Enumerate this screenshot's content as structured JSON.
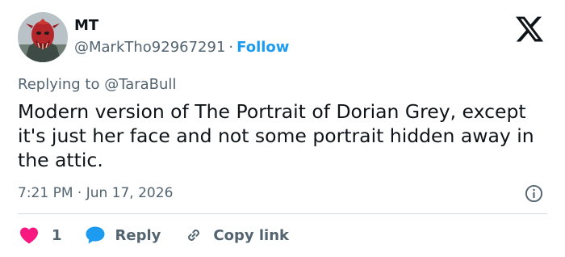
{
  "author": {
    "name": "MT",
    "handle": "@MarkTho92967291",
    "separator": "·",
    "follow_label": "Follow"
  },
  "reply_context": {
    "prefix": "Replying to ",
    "mention": "@TaraBull"
  },
  "tweet": {
    "text": "Modern version of The Portrait of Dorian Grey, except it's just her face and not some portrait hidden away in the attic.",
    "timestamp": "7:21 PM · Jun 17, 2026"
  },
  "actions": {
    "like_count": "1",
    "reply_label": "Reply",
    "copy_label": "Copy link"
  },
  "icons": {
    "brand": "x-logo-icon",
    "info": "info-icon",
    "like": "heart-icon",
    "reply": "speech-bubble-icon",
    "copy": "link-icon"
  },
  "colors": {
    "text": "#0f1419",
    "secondary": "#536471",
    "accent": "#1d9bf0",
    "like": "#f91880",
    "divider": "#cfd9de"
  }
}
